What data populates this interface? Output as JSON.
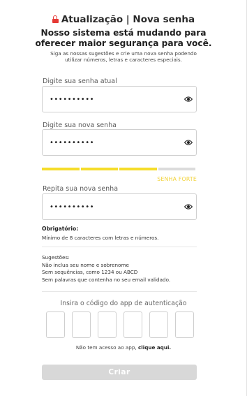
{
  "header": {
    "title": "Atualização | Nova senha",
    "headline_line1": "Nosso sistema está mudando para",
    "headline_line2": "oferecer maior segurança para você.",
    "subtext_line1": "Siga as nossas sugestões e crie uma nova senha podendo",
    "subtext_line2": "utilizar números, letras e caracteres especiais.",
    "lock_icon": "lock-icon"
  },
  "fields": {
    "current": {
      "label": "Digite sua senha atual",
      "value": "••••••••••",
      "icon": "eye-icon"
    },
    "new": {
      "label": "Digite sua nova senha",
      "value": "••••••••••",
      "icon": "eye-icon"
    },
    "repeat": {
      "label": "Repita sua nova senha",
      "value": "••••••••••",
      "icon": "eye-icon"
    }
  },
  "strength": {
    "label": "SENHA FORTE",
    "filled_segments": 3,
    "total_segments": 4,
    "fill_color": "#f5dd2b",
    "empty_color": "#dcdcdc",
    "label_color": "#f2d33a"
  },
  "requirements": {
    "title": "Obrigatório:",
    "text": "Mínimo de 8 caracteres com letras e números."
  },
  "suggestions": {
    "title": "Sugestões:",
    "items": [
      "Não inclua seu nome e sobrenome",
      "Sem sequências, como 1234 ou ABCD",
      "Sem palavras que contenha no seu email validado."
    ]
  },
  "auth_code": {
    "label": "Insira o código do app de autenticação",
    "digits": [
      "",
      "",
      "",
      "",
      "",
      ""
    ]
  },
  "no_access": {
    "text": "Não tem acesso ao app,",
    "link": "clique aqui."
  },
  "submit": {
    "label": "Criar",
    "bg_color": "#d8d8d8"
  },
  "colors": {
    "lock": "#e53935"
  }
}
